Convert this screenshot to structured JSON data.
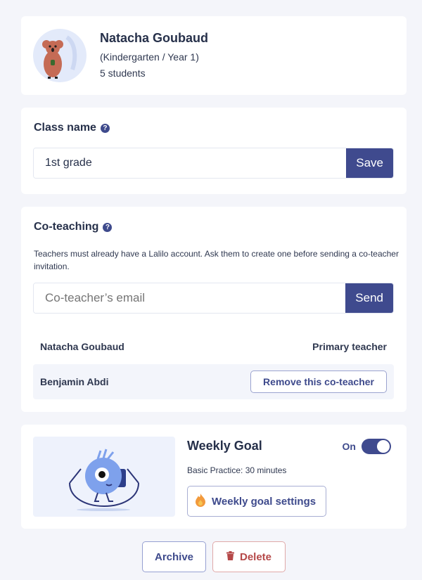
{
  "profile": {
    "name": "Natacha Goubaud",
    "grade": "(Kindergarten / Year 1)",
    "students": "5 students",
    "avatar_icon": "koala-avatar-icon"
  },
  "class_name": {
    "title": "Class name",
    "help_icon": "question-circle-icon",
    "value": "1st grade",
    "save_label": "Save"
  },
  "coteaching": {
    "title": "Co-teaching",
    "help_icon": "question-circle-icon",
    "description": "Teachers must already have a Lalilo account. Ask them to create one before sending a co-teacher invitation.",
    "email_placeholder": "Co-teacher’s email",
    "email_value": "",
    "send_label": "Send",
    "teachers": [
      {
        "name": "Natacha Goubaud",
        "role": "Primary teacher"
      },
      {
        "name": "Benjamin Abdi",
        "action_label": "Remove this co-teacher"
      }
    ]
  },
  "weekly_goal": {
    "title": "Weekly Goal",
    "toggle_label": "On",
    "toggle_on": true,
    "subtitle": "Basic Practice: 30 minutes",
    "settings_label": "Weekly goal settings",
    "settings_icon": "flame-icon"
  },
  "actions": {
    "archive_label": "Archive",
    "delete_label": "Delete",
    "delete_icon": "trash-icon"
  },
  "colors": {
    "primary": "#3f4a8e",
    "danger": "#b54848",
    "background": "#f4f5fa"
  }
}
